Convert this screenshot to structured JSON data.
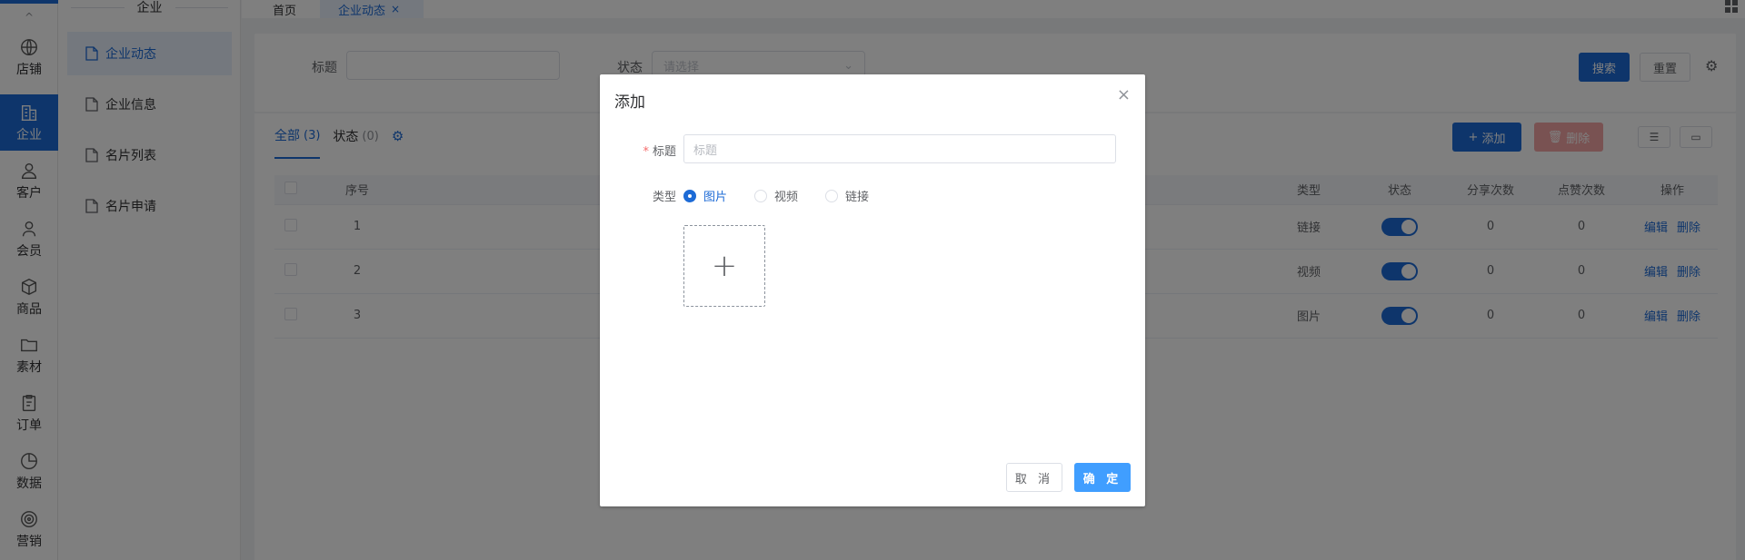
{
  "rail": {
    "collapse": "^",
    "items": [
      {
        "label": "店铺",
        "icon": "globe-icon"
      },
      {
        "label": "企业",
        "icon": "building-icon",
        "active": true
      },
      {
        "label": "客户",
        "icon": "user-icon"
      },
      {
        "label": "会员",
        "icon": "member-icon"
      },
      {
        "label": "商品",
        "icon": "box-icon"
      },
      {
        "label": "素材",
        "icon": "folder-icon"
      },
      {
        "label": "订单",
        "icon": "order-icon"
      },
      {
        "label": "数据",
        "icon": "pie-icon"
      },
      {
        "label": "营销",
        "icon": "target-icon"
      }
    ]
  },
  "submenu": {
    "title": "企业",
    "items": [
      {
        "label": "企业动态",
        "active": true
      },
      {
        "label": "企业信息"
      },
      {
        "label": "名片列表"
      },
      {
        "label": "名片申请"
      }
    ]
  },
  "tabs": {
    "home": "首页",
    "active": "企业动态",
    "close": "×"
  },
  "search": {
    "title_label": "标题",
    "status_label": "状态",
    "status_placeholder": "请选择",
    "search_button": "搜索",
    "reset_button": "重置"
  },
  "list": {
    "tabs": [
      {
        "label": "全部",
        "count": "(3)",
        "active": true
      },
      {
        "label": "状态",
        "count": "(0)"
      }
    ],
    "add_button": "添加",
    "delete_button": "删除",
    "columns": [
      "序号",
      "类型",
      "状态",
      "分享次数",
      "点赞次数",
      "操作"
    ],
    "rows": [
      {
        "index": "1",
        "type": "链接",
        "share": "0",
        "like": "0"
      },
      {
        "index": "2",
        "type": "视频",
        "share": "0",
        "like": "0"
      },
      {
        "index": "3",
        "type": "图片",
        "share": "0",
        "like": "0"
      }
    ],
    "edit_label": "编辑",
    "delete_label": "删除"
  },
  "dialog": {
    "title": "添加",
    "close": "×",
    "title_label": "标题",
    "title_required": "*",
    "title_placeholder": "标题",
    "type_label": "类型",
    "type_options": [
      {
        "label": "图片",
        "checked": true
      },
      {
        "label": "视频"
      },
      {
        "label": "链接"
      }
    ],
    "upload_plus": "+",
    "cancel": "取 消",
    "confirm": "确 定"
  },
  "colors": {
    "primary": "#1d6bd6",
    "confirm": "#409eff",
    "danger_disabled": "#f3a5a5",
    "required": "#f56c6c"
  }
}
